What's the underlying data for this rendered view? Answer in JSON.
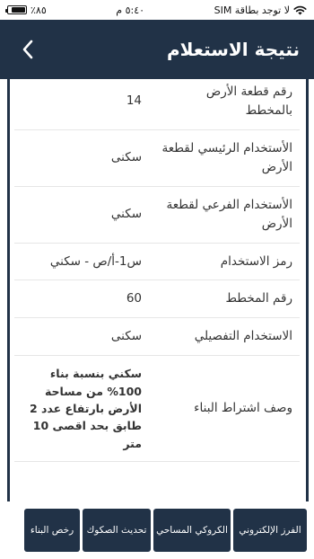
{
  "status_bar": {
    "carrier": "لا توجد بطاقة SIM",
    "time": "٥:٤٠ م",
    "battery": "٪٨٥",
    "battery_level": 0.85
  },
  "header": {
    "title": "نتيجة الاستعلام",
    "back_icon": "chevron-left-icon"
  },
  "colors": {
    "primary": "#213247",
    "background": "#ffffff",
    "divider": "#e6e6e6"
  },
  "rows": [
    {
      "label": "رقم قطعة الأرض بالمخطط",
      "value": "14"
    },
    {
      "label": "الأستخدام الرئيسي لقطعة الأرض",
      "value": "سكنى"
    },
    {
      "label": "الأستخدام الفرعي لقطعة الأرض",
      "value": "سكني"
    },
    {
      "label": "رمز الاستخدام",
      "value": "س1-أ/ص - سكني"
    },
    {
      "label": "رقم المخطط",
      "value": "60"
    },
    {
      "label": "الاستخدام التفصيلي",
      "value": "سكنى"
    },
    {
      "label": "وصف اشتراط البناء",
      "value": "سكني بنسبة بناء 100% من مساحة الأرض بارتفاع عدد 2 طابق بحد اقصى 10 متر"
    }
  ],
  "bottom_nav": {
    "items": [
      {
        "label": "الفرز الإلكتروني"
      },
      {
        "label": "الكروكي المساحي"
      },
      {
        "label": "تحديث الصكوك"
      },
      {
        "label": "رخص البناء"
      }
    ]
  }
}
